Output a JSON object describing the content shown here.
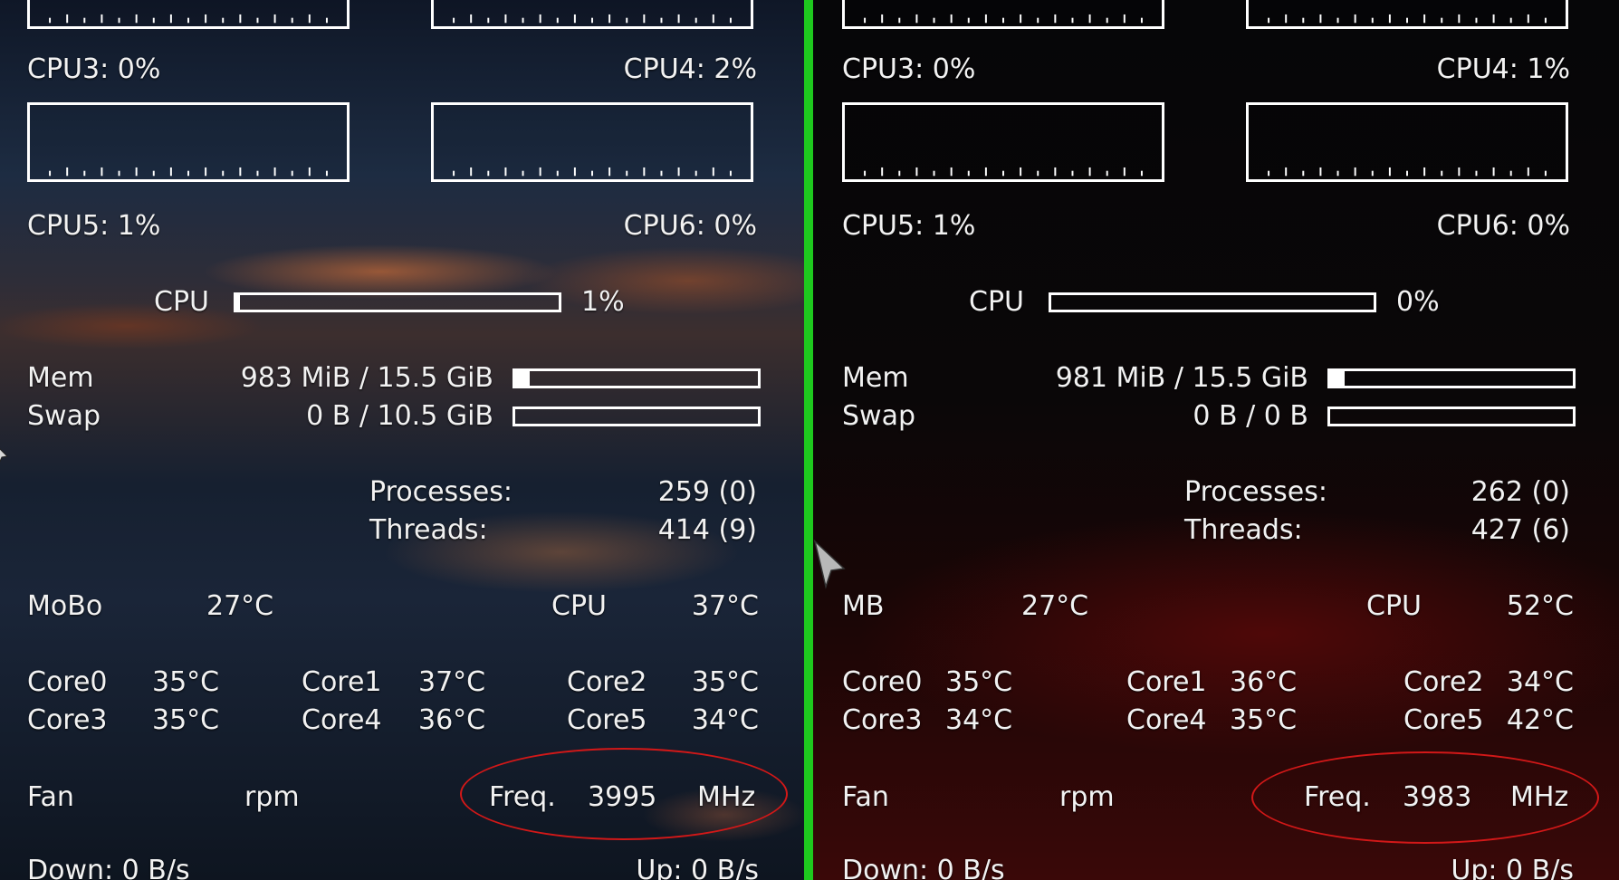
{
  "left": {
    "cpu_cores": [
      {
        "label": "CPU3: 0%"
      },
      {
        "label": "CPU4: 2%"
      },
      {
        "label": "CPU5: 1%"
      },
      {
        "label": "CPU6: 0%"
      }
    ],
    "cpu_total": {
      "label": "CPU",
      "percent_text": "1%",
      "level": 0.01
    },
    "mem": {
      "label": "Mem",
      "value": "983 MiB / 15.5 GiB",
      "level": 0.06
    },
    "swap": {
      "label": "Swap",
      "value": "0 B / 10.5 GiB",
      "level": 0.0
    },
    "processes": {
      "label": "Processes:",
      "value": "259 (0)"
    },
    "threads": {
      "label": "Threads:",
      "value": "414 (9)"
    },
    "temps": {
      "board_label": "MoBo",
      "board_value": "27°C",
      "cpu_label": "CPU",
      "cpu_value": "37°C"
    },
    "cores": [
      {
        "label": "Core0",
        "value": "35°C"
      },
      {
        "label": "Core1",
        "value": "37°C"
      },
      {
        "label": "Core2",
        "value": "35°C"
      },
      {
        "label": "Core3",
        "value": "35°C"
      },
      {
        "label": "Core4",
        "value": "36°C"
      },
      {
        "label": "Core5",
        "value": "34°C"
      }
    ],
    "fan": {
      "label": "Fan",
      "unit": "rpm"
    },
    "freq": {
      "label": "Freq.",
      "value": "3995",
      "unit": "MHz"
    },
    "net": {
      "down": "Down: 0 B/s",
      "up": "Up: 0 B/s"
    }
  },
  "right": {
    "cpu_cores": [
      {
        "label": "CPU3: 0%"
      },
      {
        "label": "CPU4: 1%"
      },
      {
        "label": "CPU5: 1%"
      },
      {
        "label": "CPU6: 0%"
      }
    ],
    "cpu_total": {
      "label": "CPU",
      "percent_text": "0%",
      "level": 0.0
    },
    "mem": {
      "label": "Mem",
      "value": "981 MiB / 15.5 GiB",
      "level": 0.06
    },
    "swap": {
      "label": "Swap",
      "value": "0 B / 0 B",
      "level": 0.0
    },
    "processes": {
      "label": "Processes:",
      "value": "262 (0)"
    },
    "threads": {
      "label": "Threads:",
      "value": "427 (6)"
    },
    "temps": {
      "board_label": "MB",
      "board_value": "27°C",
      "cpu_label": "CPU",
      "cpu_value": "52°C"
    },
    "cores": [
      {
        "label": "Core0",
        "value": "35°C"
      },
      {
        "label": "Core1",
        "value": "36°C"
      },
      {
        "label": "Core2",
        "value": "34°C"
      },
      {
        "label": "Core3",
        "value": "34°C"
      },
      {
        "label": "Core4",
        "value": "35°C"
      },
      {
        "label": "Core5",
        "value": "42°C"
      }
    ],
    "fan": {
      "label": "Fan",
      "unit": "rpm"
    },
    "freq": {
      "label": "Freq.",
      "value": "3983",
      "unit": "MHz"
    },
    "net": {
      "down": "Down: 0 B/s",
      "up": "Up: 0 B/s"
    }
  },
  "colors": {
    "divider": "#1ec91e",
    "highlight_ring": "#d21818",
    "foreground": "#ffffff"
  },
  "icons": [
    "mouse-pointer-icon"
  ]
}
